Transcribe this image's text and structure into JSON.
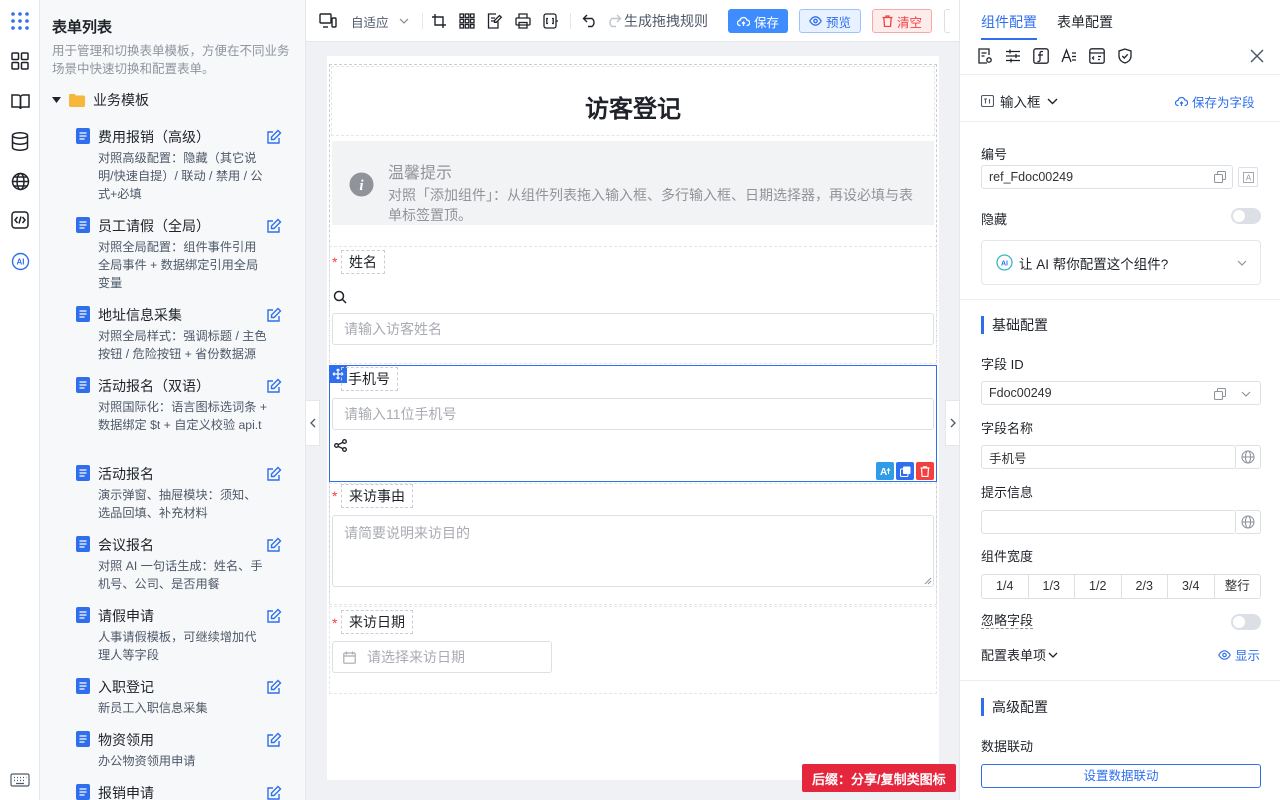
{
  "colors": {
    "primary": "#2f6fed",
    "danger": "#f53f3f",
    "save_bg": "#3f8cff",
    "preview_bg": "#e8f1ff",
    "clear_bg": "#fdecec",
    "footer_badge_bg": "#e5273e"
  },
  "sidebar_rail": {
    "icons": [
      "apps-grid-icon",
      "layout-icon",
      "book-icon",
      "database-icon",
      "globe-icon",
      "code-icon",
      "ai-icon",
      "keyboard-icon"
    ]
  },
  "form_list": {
    "title": "表单列表",
    "description": "用于管理和切换表单模板，方便在不同业务场景中快速切换和配置表单。",
    "folder_label": "业务模板",
    "templates": [
      {
        "name": "费用报销（高级）",
        "desc": "对照高级配置：隐藏（其它说明/快速自提）/ 联动 / 禁用 / 公式+必填"
      },
      {
        "name": "员工请假（全局）",
        "desc": "对照全局配置：组件事件引用全局事件 + 数据绑定引用全局变量"
      },
      {
        "name": "地址信息采集",
        "desc": "对照全局样式：强调标题 / 主色按钮 / 危险按钮 + 省份数据源"
      },
      {
        "name": "活动报名（双语）",
        "desc": "对照国际化：语言图标选词条 + 数据绑定 $t + 自定义校验 api.t"
      },
      {
        "name": "活动报名",
        "desc": "演示弹窗、抽屉模块：须知、选品回填、补充材料"
      },
      {
        "name": "会议报名",
        "desc": "对照 AI 一句话生成：姓名、手机号、公司、是否用餐"
      },
      {
        "name": "请假申请",
        "desc": "人事请假模板，可继续增加代理人等字段"
      },
      {
        "name": "入职登记",
        "desc": "新员工入职信息采集"
      },
      {
        "name": "物资领用",
        "desc": "办公物资领用申请"
      },
      {
        "name": "报销申请",
        "desc": ""
      }
    ]
  },
  "toolbar": {
    "fit_label": "自适应",
    "generate_rule_label": "生成拖拽规则",
    "save_label": "保存",
    "preview_label": "预览",
    "clear_label": "清空"
  },
  "form": {
    "title": "访客登记",
    "tip_title": "温馨提示",
    "tip_text": "对照「添加组件」：从组件列表拖入输入框、多行输入框、日期选择器，再设必填与表单标签置顶。",
    "name_label": "姓名",
    "name_placeholder": "请输入访客姓名",
    "phone_label": "手机号",
    "phone_placeholder": "请输入11位手机号",
    "reason_label": "来访事由",
    "reason_placeholder": "请简要说明来访目的",
    "date_label": "来访日期",
    "date_placeholder": "请选择来访日期"
  },
  "footer_badge": "后缀：分享/复制类图标",
  "panel": {
    "tabs": [
      "组件配置",
      "表单配置"
    ],
    "component_type": "输入框",
    "save_as_field": "保存为字段",
    "id_label": "编号",
    "id_value": "ref_Fdoc00249",
    "hidden_label": "隐藏",
    "ai_prompt": "让 AI 帮你配置这个组件?",
    "basic_section": "基础配置",
    "field_id_label": "字段 ID",
    "field_id_value": "Fdoc00249",
    "field_name_label": "字段名称",
    "field_name_value": "手机号",
    "hint_label": "提示信息",
    "hint_value": "",
    "width_label": "组件宽度",
    "width_options": [
      "1/4",
      "1/3",
      "1/2",
      "2/3",
      "3/4",
      "整行"
    ],
    "ignore_label": "忽略字段",
    "config_items_label": "配置表单项",
    "show_label": "显示",
    "advanced_section": "高级配置",
    "linkage_label": "数据联动",
    "linkage_button": "设置数据联动"
  }
}
